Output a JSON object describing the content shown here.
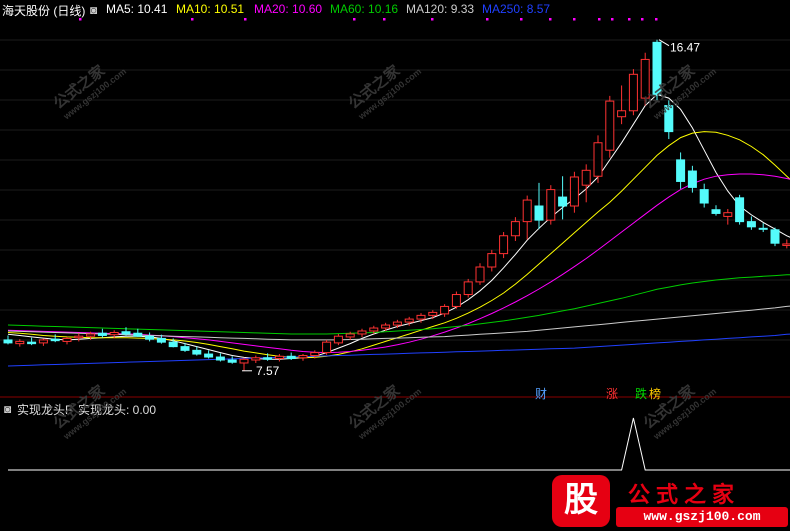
{
  "header": {
    "stock_name": "海天股份 (日线)",
    "ma": [
      {
        "label": "MA5: 10.41",
        "color": "#ffffff"
      },
      {
        "label": "MA10: 10.51",
        "color": "#ffff00"
      },
      {
        "label": "MA20: 10.60",
        "color": "#ff00ff"
      },
      {
        "label": "MA60: 10.16",
        "color": "#00cc00"
      },
      {
        "label": "MA120: 9.33",
        "color": "#cccccc"
      },
      {
        "label": "MA250: 8.57",
        "color": "#2040ff"
      }
    ]
  },
  "indicator": {
    "title": "实现龙头F",
    "value_label": "实现龙头: 0.00"
  },
  "event_markers": [
    "财",
    "涨",
    "跌",
    "榜"
  ],
  "watermark": {
    "text": "公式之家",
    "url": "www.gszj100.com"
  },
  "brand": {
    "badge": "股",
    "name": "公式之家",
    "url": "www.gszj100.com"
  },
  "colors": {
    "up": "#ff3232",
    "down": "#54fcfc",
    "background": "#000000"
  },
  "chart_data": {
    "type": "candlestick",
    "period": "daily",
    "high_annotation": "16.47",
    "low_annotation": "7.57",
    "high_value": 16.47,
    "low_value": 7.57,
    "ylim": [
      7.0,
      17.0
    ],
    "candles": [
      {
        "o": 8.4,
        "h": 8.52,
        "l": 8.28,
        "c": 8.32
      },
      {
        "o": 8.3,
        "h": 8.42,
        "l": 8.22,
        "c": 8.36
      },
      {
        "o": 8.34,
        "h": 8.46,
        "l": 8.26,
        "c": 8.3
      },
      {
        "o": 8.32,
        "h": 8.44,
        "l": 8.24,
        "c": 8.4
      },
      {
        "o": 8.42,
        "h": 8.55,
        "l": 8.34,
        "c": 8.38
      },
      {
        "o": 8.36,
        "h": 8.48,
        "l": 8.28,
        "c": 8.44
      },
      {
        "o": 8.46,
        "h": 8.58,
        "l": 8.36,
        "c": 8.5
      },
      {
        "o": 8.5,
        "h": 8.62,
        "l": 8.4,
        "c": 8.56
      },
      {
        "o": 8.58,
        "h": 8.7,
        "l": 8.46,
        "c": 8.52
      },
      {
        "o": 8.54,
        "h": 8.66,
        "l": 8.44,
        "c": 8.6
      },
      {
        "o": 8.62,
        "h": 8.74,
        "l": 8.52,
        "c": 8.56
      },
      {
        "o": 8.58,
        "h": 8.7,
        "l": 8.48,
        "c": 8.5
      },
      {
        "o": 8.5,
        "h": 8.6,
        "l": 8.36,
        "c": 8.42
      },
      {
        "o": 8.44,
        "h": 8.54,
        "l": 8.3,
        "c": 8.34
      },
      {
        "o": 8.34,
        "h": 8.44,
        "l": 8.2,
        "c": 8.22
      },
      {
        "o": 8.22,
        "h": 8.32,
        "l": 8.08,
        "c": 8.12
      },
      {
        "o": 8.12,
        "h": 8.22,
        "l": 7.98,
        "c": 8.02
      },
      {
        "o": 8.02,
        "h": 8.12,
        "l": 7.9,
        "c": 7.94
      },
      {
        "o": 7.94,
        "h": 8.04,
        "l": 7.82,
        "c": 7.86
      },
      {
        "o": 7.86,
        "h": 7.96,
        "l": 7.76,
        "c": 7.8
      },
      {
        "o": 7.78,
        "h": 7.92,
        "l": 7.57,
        "c": 7.88
      },
      {
        "o": 7.86,
        "h": 7.98,
        "l": 7.78,
        "c": 7.92
      },
      {
        "o": 7.92,
        "h": 8.04,
        "l": 7.84,
        "c": 7.88
      },
      {
        "o": 7.9,
        "h": 8.02,
        "l": 7.82,
        "c": 7.96
      },
      {
        "o": 7.96,
        "h": 8.06,
        "l": 7.86,
        "c": 7.9
      },
      {
        "o": 7.92,
        "h": 8.02,
        "l": 7.84,
        "c": 7.98
      },
      {
        "o": 7.98,
        "h": 8.12,
        "l": 7.9,
        "c": 8.06
      },
      {
        "o": 8.06,
        "h": 8.4,
        "l": 8.0,
        "c": 8.34
      },
      {
        "o": 8.32,
        "h": 8.56,
        "l": 8.26,
        "c": 8.5
      },
      {
        "o": 8.48,
        "h": 8.62,
        "l": 8.4,
        "c": 8.56
      },
      {
        "o": 8.56,
        "h": 8.7,
        "l": 8.48,
        "c": 8.64
      },
      {
        "o": 8.64,
        "h": 8.78,
        "l": 8.56,
        "c": 8.72
      },
      {
        "o": 8.72,
        "h": 8.86,
        "l": 8.64,
        "c": 8.8
      },
      {
        "o": 8.8,
        "h": 8.94,
        "l": 8.72,
        "c": 8.88
      },
      {
        "o": 8.88,
        "h": 9.02,
        "l": 8.78,
        "c": 8.96
      },
      {
        "o": 8.96,
        "h": 9.12,
        "l": 8.86,
        "c": 9.06
      },
      {
        "o": 9.06,
        "h": 9.2,
        "l": 8.96,
        "c": 9.14
      },
      {
        "o": 9.1,
        "h": 9.36,
        "l": 9.02,
        "c": 9.3
      },
      {
        "o": 9.3,
        "h": 9.7,
        "l": 9.24,
        "c": 9.62
      },
      {
        "o": 9.62,
        "h": 10.04,
        "l": 9.54,
        "c": 9.96
      },
      {
        "o": 9.96,
        "h": 10.46,
        "l": 9.88,
        "c": 10.36
      },
      {
        "o": 10.36,
        "h": 10.82,
        "l": 10.24,
        "c": 10.72
      },
      {
        "o": 10.72,
        "h": 11.3,
        "l": 10.6,
        "c": 11.2
      },
      {
        "o": 11.2,
        "h": 11.7,
        "l": 11.06,
        "c": 11.58
      },
      {
        "o": 11.58,
        "h": 12.28,
        "l": 11.1,
        "c": 12.16
      },
      {
        "o": 12.0,
        "h": 12.62,
        "l": 11.38,
        "c": 11.62
      },
      {
        "o": 11.62,
        "h": 12.56,
        "l": 11.5,
        "c": 12.44
      },
      {
        "o": 12.24,
        "h": 12.8,
        "l": 11.64,
        "c": 12.0
      },
      {
        "o": 12.0,
        "h": 12.92,
        "l": 11.82,
        "c": 12.78
      },
      {
        "o": 12.56,
        "h": 13.12,
        "l": 12.1,
        "c": 12.96
      },
      {
        "o": 12.8,
        "h": 13.9,
        "l": 12.62,
        "c": 13.7
      },
      {
        "o": 13.5,
        "h": 14.96,
        "l": 13.3,
        "c": 14.82
      },
      {
        "o": 14.4,
        "h": 15.24,
        "l": 14.2,
        "c": 14.56
      },
      {
        "o": 14.56,
        "h": 15.68,
        "l": 14.44,
        "c": 15.54
      },
      {
        "o": 14.9,
        "h": 16.12,
        "l": 14.7,
        "c": 15.94
      },
      {
        "o": 16.4,
        "h": 16.47,
        "l": 14.84,
        "c": 15.0
      },
      {
        "o": 14.7,
        "h": 14.84,
        "l": 13.8,
        "c": 14.0
      },
      {
        "o": 13.24,
        "h": 13.44,
        "l": 12.46,
        "c": 12.66
      },
      {
        "o": 12.94,
        "h": 13.08,
        "l": 12.36,
        "c": 12.5
      },
      {
        "o": 12.44,
        "h": 12.6,
        "l": 11.96,
        "c": 12.08
      },
      {
        "o": 11.9,
        "h": 12.02,
        "l": 11.74,
        "c": 11.8
      },
      {
        "o": 11.72,
        "h": 11.92,
        "l": 11.5,
        "c": 11.82
      },
      {
        "o": 12.22,
        "h": 12.3,
        "l": 11.5,
        "c": 11.58
      },
      {
        "o": 11.58,
        "h": 11.72,
        "l": 11.36,
        "c": 11.44
      },
      {
        "o": 11.4,
        "h": 11.54,
        "l": 11.3,
        "c": 11.38
      },
      {
        "o": 11.36,
        "h": 11.42,
        "l": 10.92,
        "c": 11.0
      },
      {
        "o": 10.94,
        "h": 11.1,
        "l": 10.86,
        "c": 10.98
      },
      {
        "o": 10.98,
        "h": 11.14,
        "l": 10.88,
        "c": 11.06
      }
    ],
    "series": [
      {
        "name": "MA5",
        "color": "#ffffff",
        "values": [
          8.55,
          8.52,
          8.48,
          8.45,
          8.42,
          8.4,
          8.42,
          8.44,
          8.46,
          8.48,
          8.5,
          8.5,
          8.48,
          8.44,
          8.38,
          8.3,
          8.22,
          8.14,
          8.06,
          7.98,
          7.93,
          7.9,
          7.88,
          7.88,
          7.9,
          7.92,
          7.96,
          8.06,
          8.18,
          8.3,
          8.44,
          8.56,
          8.66,
          8.76,
          8.84,
          8.92,
          9.0,
          9.12,
          9.28,
          9.48,
          9.72,
          10.0,
          10.34,
          10.7,
          11.08,
          11.4,
          11.7,
          11.96,
          12.2,
          12.46,
          12.78,
          13.24,
          13.7,
          14.2,
          14.7,
          15.0,
          14.9,
          14.6,
          14.1,
          13.5,
          12.9,
          12.4,
          12.0,
          11.76,
          11.56,
          11.38,
          11.2,
          11.06
        ]
      },
      {
        "name": "MA10",
        "color": "#ffff00",
        "values": [
          8.6,
          8.58,
          8.55,
          8.52,
          8.5,
          8.48,
          8.47,
          8.46,
          8.46,
          8.46,
          8.46,
          8.45,
          8.44,
          8.42,
          8.4,
          8.37,
          8.33,
          8.28,
          8.22,
          8.16,
          8.1,
          8.05,
          8.0,
          7.96,
          7.93,
          7.92,
          7.93,
          7.96,
          8.01,
          8.08,
          8.16,
          8.26,
          8.36,
          8.46,
          8.56,
          8.66,
          8.76,
          8.86,
          8.98,
          9.12,
          9.28,
          9.46,
          9.66,
          9.9,
          10.16,
          10.44,
          10.72,
          11.0,
          11.28,
          11.56,
          11.84,
          12.1,
          12.4,
          12.72,
          13.04,
          13.36,
          13.62,
          13.84,
          13.96,
          14.0,
          13.98,
          13.9,
          13.78,
          13.6,
          13.38,
          13.1,
          12.8,
          12.5
        ]
      },
      {
        "name": "MA20",
        "color": "#ff00ff",
        "values": [
          8.66,
          8.65,
          8.64,
          8.63,
          8.62,
          8.61,
          8.6,
          8.59,
          8.58,
          8.57,
          8.56,
          8.55,
          8.53,
          8.51,
          8.49,
          8.46,
          8.43,
          8.4,
          8.36,
          8.32,
          8.28,
          8.24,
          8.2,
          8.16,
          8.12,
          8.09,
          8.07,
          8.06,
          8.07,
          8.09,
          8.12,
          8.16,
          8.21,
          8.27,
          8.34,
          8.42,
          8.51,
          8.61,
          8.72,
          8.84,
          8.97,
          9.11,
          9.26,
          9.42,
          9.59,
          9.77,
          9.96,
          10.16,
          10.37,
          10.59,
          10.82,
          11.06,
          11.3,
          11.54,
          11.78,
          12.02,
          12.24,
          12.44,
          12.6,
          12.72,
          12.8,
          12.84,
          12.86,
          12.86,
          12.84,
          12.8,
          12.74,
          12.66
        ]
      },
      {
        "name": "MA60",
        "color": "#00cc00",
        "values": [
          8.8,
          8.79,
          8.78,
          8.77,
          8.76,
          8.75,
          8.74,
          8.73,
          8.72,
          8.71,
          8.7,
          8.69,
          8.68,
          8.67,
          8.66,
          8.65,
          8.64,
          8.63,
          8.62,
          8.61,
          8.6,
          8.59,
          8.58,
          8.57,
          8.56,
          8.56,
          8.56,
          8.56,
          8.57,
          8.58,
          8.59,
          8.6,
          8.62,
          8.64,
          8.66,
          8.68,
          8.7,
          8.73,
          8.76,
          8.79,
          8.83,
          8.87,
          8.91,
          8.96,
          9.01,
          9.06,
          9.12,
          9.18,
          9.24,
          9.31,
          9.38,
          9.45,
          9.52,
          9.6,
          9.68,
          9.76,
          9.82,
          9.88,
          9.93,
          9.97,
          10.01,
          10.04,
          10.07,
          10.09,
          10.11,
          10.13,
          10.15,
          10.16
        ]
      },
      {
        "name": "MA120",
        "color": "#cccccc",
        "values": [
          8.64,
          8.63,
          8.62,
          8.61,
          8.6,
          8.59,
          8.58,
          8.57,
          8.56,
          8.55,
          8.54,
          8.53,
          8.52,
          8.51,
          8.5,
          8.49,
          8.48,
          8.47,
          8.46,
          8.45,
          8.44,
          8.43,
          8.42,
          8.41,
          8.4,
          8.4,
          8.4,
          8.4,
          8.4,
          8.41,
          8.42,
          8.43,
          8.44,
          8.45,
          8.46,
          8.47,
          8.48,
          8.49,
          8.51,
          8.53,
          8.55,
          8.57,
          8.59,
          8.61,
          8.63,
          8.66,
          8.69,
          8.72,
          8.75,
          8.78,
          8.81,
          8.84,
          8.87,
          8.9,
          8.93,
          8.96,
          8.99,
          9.02,
          9.05,
          9.08,
          9.11,
          9.14,
          9.17,
          9.2,
          9.23,
          9.26,
          9.3,
          9.33
        ]
      },
      {
        "name": "MA250",
        "color": "#2040ff",
        "values": [
          7.7,
          7.71,
          7.72,
          7.73,
          7.74,
          7.75,
          7.76,
          7.77,
          7.78,
          7.79,
          7.8,
          7.81,
          7.82,
          7.83,
          7.84,
          7.85,
          7.86,
          7.87,
          7.88,
          7.89,
          7.9,
          7.91,
          7.92,
          7.93,
          7.94,
          7.95,
          7.96,
          7.97,
          7.98,
          7.99,
          8.0,
          8.01,
          8.02,
          8.03,
          8.04,
          8.05,
          8.06,
          8.07,
          8.08,
          8.09,
          8.1,
          8.11,
          8.12,
          8.13,
          8.14,
          8.15,
          8.16,
          8.17,
          8.18,
          8.2,
          8.22,
          8.24,
          8.26,
          8.28,
          8.3,
          8.32,
          8.34,
          8.36,
          8.38,
          8.4,
          8.42,
          8.44,
          8.46,
          8.48,
          8.5,
          8.52,
          8.55,
          8.57
        ]
      }
    ],
    "indicator_series": {
      "name": "实现龙头",
      "values": [
        0,
        0,
        0,
        0,
        0,
        0,
        0,
        0,
        0,
        0,
        0,
        0,
        0,
        0,
        0,
        0,
        0,
        0,
        0,
        0,
        0,
        0,
        0,
        0,
        0,
        0,
        0,
        0,
        0,
        0,
        0,
        0,
        0,
        0,
        0,
        0,
        0,
        0,
        0,
        0,
        0,
        0,
        0,
        0,
        0,
        0,
        0,
        0,
        0,
        0,
        0,
        0,
        0,
        1,
        0,
        0,
        0,
        0,
        0,
        0,
        0,
        0,
        0,
        0,
        0,
        0,
        0,
        0
      ],
      "ylim": [
        0,
        1
      ]
    }
  }
}
